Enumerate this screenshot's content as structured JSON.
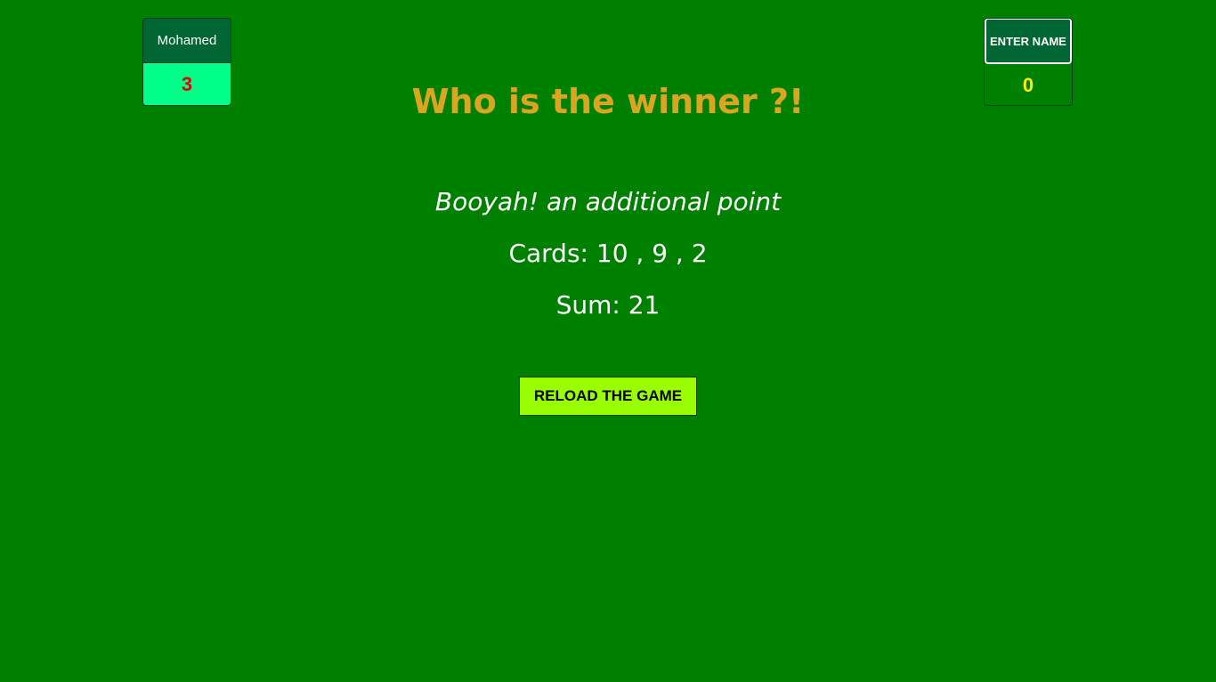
{
  "colors": {
    "background": "#008000",
    "title": "#daa520",
    "button": "#99ff00",
    "player1_score_bg": "#00ff88",
    "player1_score_text": "#e60000",
    "player2_score_text": "#ffee00"
  },
  "players": {
    "left": {
      "name": "Mohamed",
      "score": "3"
    },
    "right": {
      "name_placeholder": "ENTER NAME",
      "score": "0"
    }
  },
  "result": {
    "title": "Who is the winner ?!",
    "message": "Booyah! an additional point",
    "cards_line": "Cards: 10 , 9 , 2",
    "sum_line": "Sum: 21"
  },
  "actions": {
    "reload_label": "RELOAD THE GAME"
  }
}
